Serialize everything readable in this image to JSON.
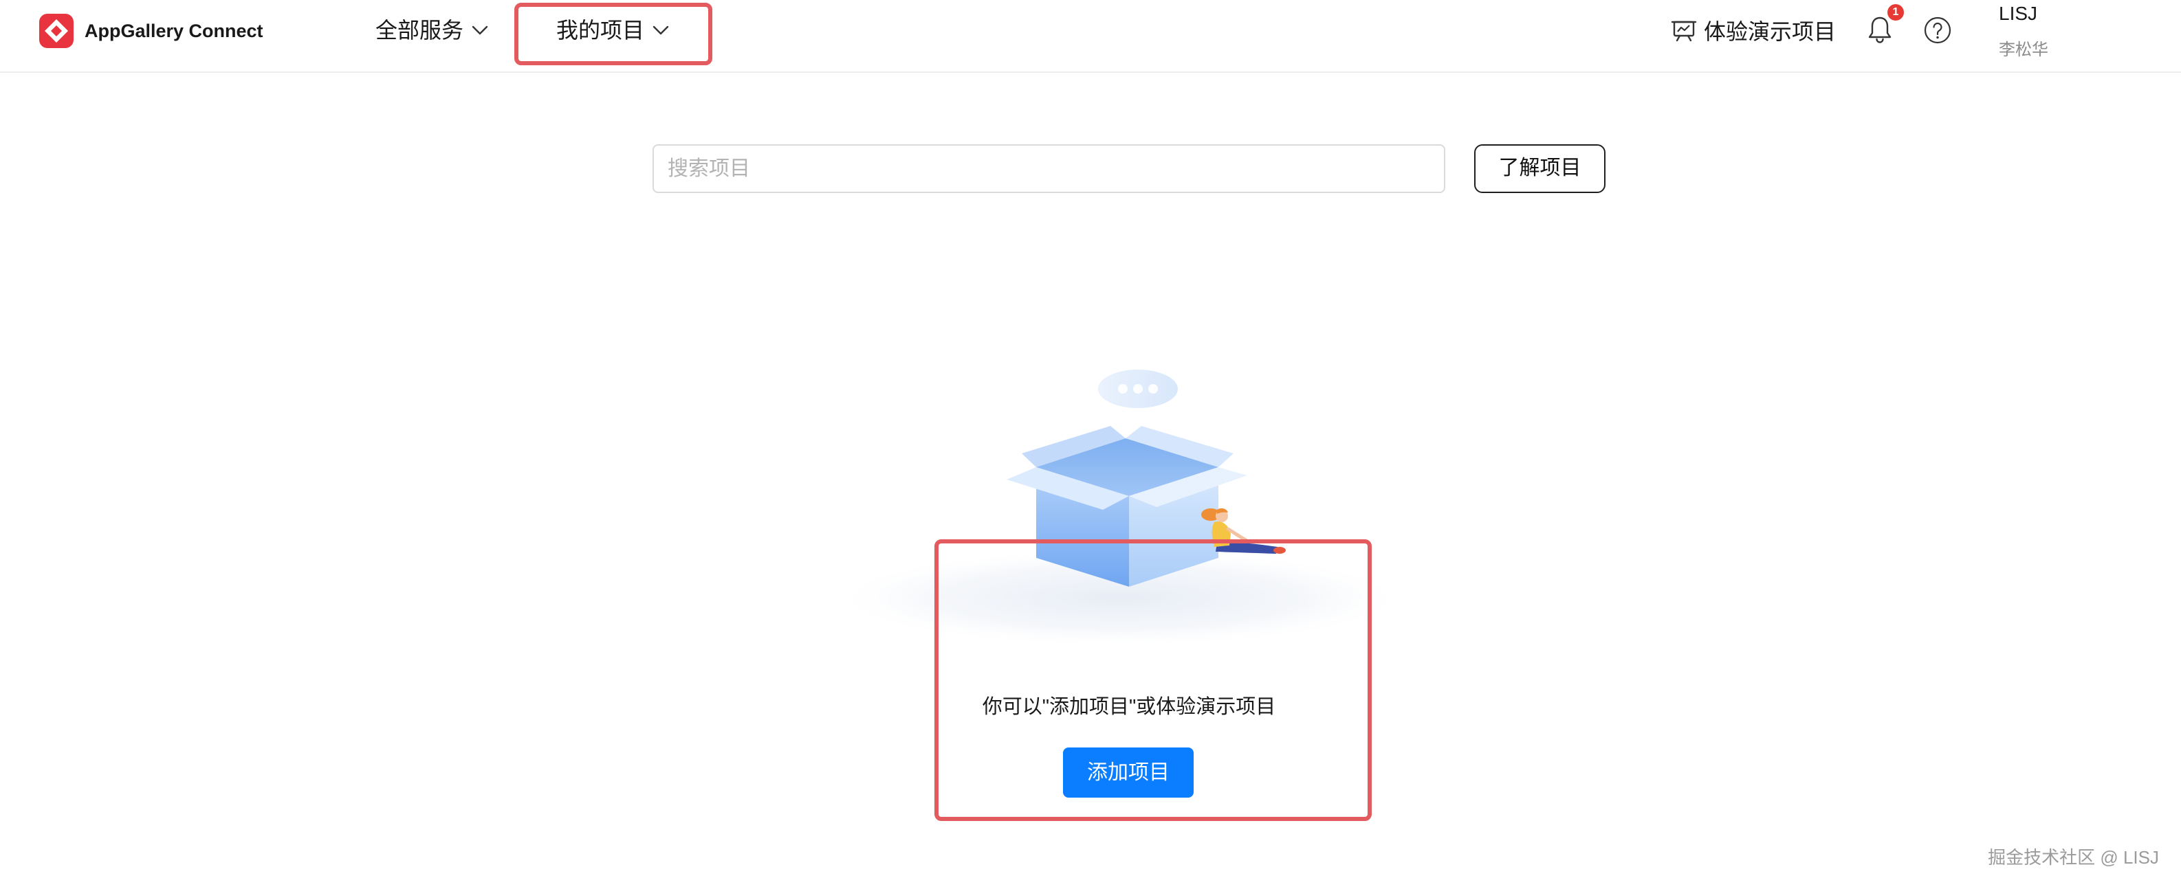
{
  "app": {
    "title": "AppGallery Connect",
    "logo_icon": "appgallery-logo-icon"
  },
  "header": {
    "nav": [
      {
        "label": "全部服务",
        "icon": "chevron-down-icon"
      },
      {
        "label": "我的项目",
        "icon": "chevron-down-icon"
      }
    ],
    "demo": {
      "label": "体验演示项目",
      "icon": "presentation-icon"
    },
    "notifications": {
      "icon": "bell-icon",
      "count": "1"
    },
    "help": {
      "icon": "help-icon"
    },
    "user": {
      "name": "LISJ",
      "real_name": "李松华"
    }
  },
  "search": {
    "placeholder": "搜索项目",
    "value": ""
  },
  "learn_button": {
    "label": "了解项目"
  },
  "empty_state": {
    "illustration": "empty-box-illustration",
    "message": "你可以\"添加项目\"或体验演示项目",
    "add_button": {
      "label": "添加项目"
    }
  },
  "watermark": "掘金技术社区 @ LISJ",
  "colors": {
    "brand_red": "#E8343F",
    "primary_blue": "#0A7EFF",
    "highlight_red": "#E35B5E",
    "badge_red": "#E83A35"
  }
}
